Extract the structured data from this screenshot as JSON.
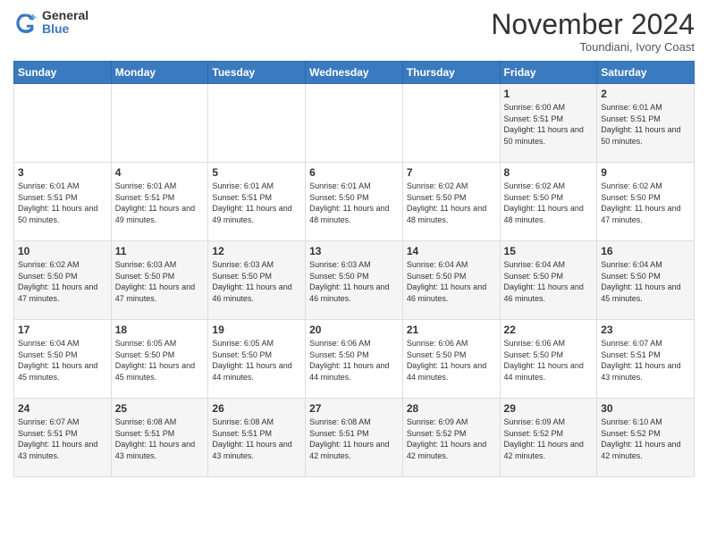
{
  "header": {
    "logo_general": "General",
    "logo_blue": "Blue",
    "month_title": "November 2024",
    "location": "Toundiani, Ivory Coast"
  },
  "weekdays": [
    "Sunday",
    "Monday",
    "Tuesday",
    "Wednesday",
    "Thursday",
    "Friday",
    "Saturday"
  ],
  "weeks": [
    [
      {
        "day": "",
        "sunrise": "",
        "sunset": "",
        "daylight": ""
      },
      {
        "day": "",
        "sunrise": "",
        "sunset": "",
        "daylight": ""
      },
      {
        "day": "",
        "sunrise": "",
        "sunset": "",
        "daylight": ""
      },
      {
        "day": "",
        "sunrise": "",
        "sunset": "",
        "daylight": ""
      },
      {
        "day": "",
        "sunrise": "",
        "sunset": "",
        "daylight": ""
      },
      {
        "day": "1",
        "sunrise": "Sunrise: 6:00 AM",
        "sunset": "Sunset: 5:51 PM",
        "daylight": "Daylight: 11 hours and 50 minutes."
      },
      {
        "day": "2",
        "sunrise": "Sunrise: 6:01 AM",
        "sunset": "Sunset: 5:51 PM",
        "daylight": "Daylight: 11 hours and 50 minutes."
      }
    ],
    [
      {
        "day": "3",
        "sunrise": "Sunrise: 6:01 AM",
        "sunset": "Sunset: 5:51 PM",
        "daylight": "Daylight: 11 hours and 50 minutes."
      },
      {
        "day": "4",
        "sunrise": "Sunrise: 6:01 AM",
        "sunset": "Sunset: 5:51 PM",
        "daylight": "Daylight: 11 hours and 49 minutes."
      },
      {
        "day": "5",
        "sunrise": "Sunrise: 6:01 AM",
        "sunset": "Sunset: 5:51 PM",
        "daylight": "Daylight: 11 hours and 49 minutes."
      },
      {
        "day": "6",
        "sunrise": "Sunrise: 6:01 AM",
        "sunset": "Sunset: 5:50 PM",
        "daylight": "Daylight: 11 hours and 48 minutes."
      },
      {
        "day": "7",
        "sunrise": "Sunrise: 6:02 AM",
        "sunset": "Sunset: 5:50 PM",
        "daylight": "Daylight: 11 hours and 48 minutes."
      },
      {
        "day": "8",
        "sunrise": "Sunrise: 6:02 AM",
        "sunset": "Sunset: 5:50 PM",
        "daylight": "Daylight: 11 hours and 48 minutes."
      },
      {
        "day": "9",
        "sunrise": "Sunrise: 6:02 AM",
        "sunset": "Sunset: 5:50 PM",
        "daylight": "Daylight: 11 hours and 47 minutes."
      }
    ],
    [
      {
        "day": "10",
        "sunrise": "Sunrise: 6:02 AM",
        "sunset": "Sunset: 5:50 PM",
        "daylight": "Daylight: 11 hours and 47 minutes."
      },
      {
        "day": "11",
        "sunrise": "Sunrise: 6:03 AM",
        "sunset": "Sunset: 5:50 PM",
        "daylight": "Daylight: 11 hours and 47 minutes."
      },
      {
        "day": "12",
        "sunrise": "Sunrise: 6:03 AM",
        "sunset": "Sunset: 5:50 PM",
        "daylight": "Daylight: 11 hours and 46 minutes."
      },
      {
        "day": "13",
        "sunrise": "Sunrise: 6:03 AM",
        "sunset": "Sunset: 5:50 PM",
        "daylight": "Daylight: 11 hours and 46 minutes."
      },
      {
        "day": "14",
        "sunrise": "Sunrise: 6:04 AM",
        "sunset": "Sunset: 5:50 PM",
        "daylight": "Daylight: 11 hours and 46 minutes."
      },
      {
        "day": "15",
        "sunrise": "Sunrise: 6:04 AM",
        "sunset": "Sunset: 5:50 PM",
        "daylight": "Daylight: 11 hours and 46 minutes."
      },
      {
        "day": "16",
        "sunrise": "Sunrise: 6:04 AM",
        "sunset": "Sunset: 5:50 PM",
        "daylight": "Daylight: 11 hours and 45 minutes."
      }
    ],
    [
      {
        "day": "17",
        "sunrise": "Sunrise: 6:04 AM",
        "sunset": "Sunset: 5:50 PM",
        "daylight": "Daylight: 11 hours and 45 minutes."
      },
      {
        "day": "18",
        "sunrise": "Sunrise: 6:05 AM",
        "sunset": "Sunset: 5:50 PM",
        "daylight": "Daylight: 11 hours and 45 minutes."
      },
      {
        "day": "19",
        "sunrise": "Sunrise: 6:05 AM",
        "sunset": "Sunset: 5:50 PM",
        "daylight": "Daylight: 11 hours and 44 minutes."
      },
      {
        "day": "20",
        "sunrise": "Sunrise: 6:06 AM",
        "sunset": "Sunset: 5:50 PM",
        "daylight": "Daylight: 11 hours and 44 minutes."
      },
      {
        "day": "21",
        "sunrise": "Sunrise: 6:06 AM",
        "sunset": "Sunset: 5:50 PM",
        "daylight": "Daylight: 11 hours and 44 minutes."
      },
      {
        "day": "22",
        "sunrise": "Sunrise: 6:06 AM",
        "sunset": "Sunset: 5:50 PM",
        "daylight": "Daylight: 11 hours and 44 minutes."
      },
      {
        "day": "23",
        "sunrise": "Sunrise: 6:07 AM",
        "sunset": "Sunset: 5:51 PM",
        "daylight": "Daylight: 11 hours and 43 minutes."
      }
    ],
    [
      {
        "day": "24",
        "sunrise": "Sunrise: 6:07 AM",
        "sunset": "Sunset: 5:51 PM",
        "daylight": "Daylight: 11 hours and 43 minutes."
      },
      {
        "day": "25",
        "sunrise": "Sunrise: 6:08 AM",
        "sunset": "Sunset: 5:51 PM",
        "daylight": "Daylight: 11 hours and 43 minutes."
      },
      {
        "day": "26",
        "sunrise": "Sunrise: 6:08 AM",
        "sunset": "Sunset: 5:51 PM",
        "daylight": "Daylight: 11 hours and 43 minutes."
      },
      {
        "day": "27",
        "sunrise": "Sunrise: 6:08 AM",
        "sunset": "Sunset: 5:51 PM",
        "daylight": "Daylight: 11 hours and 42 minutes."
      },
      {
        "day": "28",
        "sunrise": "Sunrise: 6:09 AM",
        "sunset": "Sunset: 5:52 PM",
        "daylight": "Daylight: 11 hours and 42 minutes."
      },
      {
        "day": "29",
        "sunrise": "Sunrise: 6:09 AM",
        "sunset": "Sunset: 5:52 PM",
        "daylight": "Daylight: 11 hours and 42 minutes."
      },
      {
        "day": "30",
        "sunrise": "Sunrise: 6:10 AM",
        "sunset": "Sunset: 5:52 PM",
        "daylight": "Daylight: 11 hours and 42 minutes."
      }
    ]
  ]
}
